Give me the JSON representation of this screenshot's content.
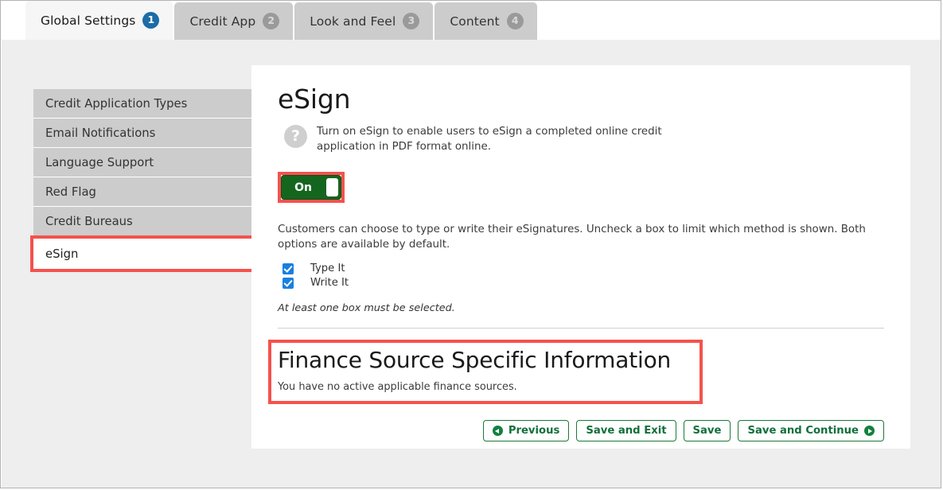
{
  "tabs": [
    {
      "label": "Global Settings",
      "badge": "1",
      "active": true
    },
    {
      "label": "Credit App",
      "badge": "2",
      "active": false
    },
    {
      "label": "Look and Feel",
      "badge": "3",
      "active": false
    },
    {
      "label": "Content",
      "badge": "4",
      "active": false
    }
  ],
  "sidebar": {
    "items": [
      {
        "label": "Credit Application Types",
        "selected": false
      },
      {
        "label": "Email Notifications",
        "selected": false
      },
      {
        "label": "Language Support",
        "selected": false
      },
      {
        "label": "Red Flag",
        "selected": false
      },
      {
        "label": "Credit Bureaus",
        "selected": false
      },
      {
        "label": "eSign",
        "selected": true
      }
    ]
  },
  "main": {
    "title": "eSign",
    "help_icon_glyph": "?",
    "help_text": "Turn on eSign to enable users to eSign a completed online credit application in PDF format online.",
    "toggle": {
      "state_label": "On",
      "on": true
    },
    "description": "Customers can choose to type or write their eSignatures. Uncheck a box to limit which method is shown. Both options are available by default.",
    "checkboxes": [
      {
        "label": "Type It",
        "checked": true
      },
      {
        "label": "Write It",
        "checked": true
      }
    ],
    "validation_note": "At least one box must be selected.",
    "finance": {
      "title": "Finance Source Specific Information",
      "subtitle": "You have no active applicable finance sources."
    },
    "buttons": [
      {
        "label": "Previous",
        "icon": "circle-arrow-left-icon",
        "icon_side": "left",
        "name": "previous-button"
      },
      {
        "label": "Save and Exit",
        "icon": null,
        "icon_side": null,
        "name": "save-and-exit-button"
      },
      {
        "label": "Save",
        "icon": null,
        "icon_side": null,
        "name": "save-button"
      },
      {
        "label": "Save and Continue",
        "icon": "circle-arrow-right-icon",
        "icon_side": "right",
        "name": "save-and-continue-button"
      }
    ]
  },
  "colors": {
    "accent_blue": "#1b6ca8",
    "toggle_green": "#14661f",
    "button_green": "#11703a",
    "checkbox_blue": "#1a7fe0",
    "highlight_red": "#f4524d",
    "tab_inactive": "#cccccc",
    "page_bg": "#eeeeee"
  }
}
